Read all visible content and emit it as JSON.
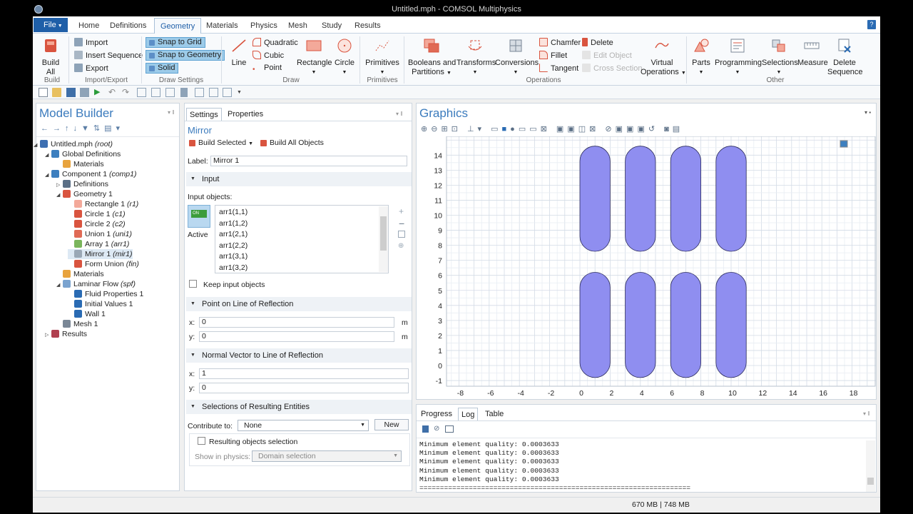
{
  "window": {
    "title": "Untitled.mph - COMSOL Multiphysics"
  },
  "menu": {
    "file_label": "File",
    "tabs": [
      "Home",
      "Definitions",
      "Geometry",
      "Materials",
      "Physics",
      "Mesh",
      "Study",
      "Results"
    ],
    "active_tab": "Geometry",
    "help": "?"
  },
  "ribbon": {
    "build": {
      "big": "Build\nAll",
      "line1": "Build",
      "line2": "All",
      "group": "Build"
    },
    "import_export": {
      "items": [
        "Import",
        "Insert Sequence",
        "Export"
      ],
      "group": "Import/Export"
    },
    "draw_settings": {
      "items": [
        "Snap to Grid",
        "Snap to Geometry",
        "Solid"
      ],
      "group": "Draw Settings"
    },
    "draw": {
      "line": "Line",
      "quadratic": "Quadratic",
      "cubic": "Cubic",
      "point": "Point",
      "rectangle": "Rectangle",
      "circle": "Circle",
      "group": "Draw"
    },
    "primitives": {
      "label": "Primitives",
      "group": "Primitives"
    },
    "operations": {
      "booleans_line1": "Booleans and",
      "booleans_line2": "Partitions",
      "transforms": "Transforms",
      "conversions": "Conversions",
      "chamfer": "Chamfer",
      "fillet": "Fillet",
      "tangent": "Tangent",
      "delete": "Delete",
      "edit_object": "Edit Object",
      "cross_section": "Cross Section",
      "virtual_line1": "Virtual",
      "virtual_line2": "Operations",
      "group": "Operations"
    },
    "other": {
      "parts": "Parts",
      "programming": "Programming",
      "selections": "Selections",
      "measure": "Measure",
      "delete_seq_line1": "Delete",
      "delete_seq_line2": "Sequence",
      "group": "Other"
    }
  },
  "model_builder": {
    "title": "Model Builder",
    "tree": [
      {
        "label": "Untitled.mph",
        "tag": "(root)"
      },
      {
        "label": "Global Definitions",
        "tag": ""
      },
      {
        "label": "Materials",
        "tag": ""
      },
      {
        "label": "Component 1",
        "tag": "(comp1)"
      },
      {
        "label": "Definitions",
        "tag": ""
      },
      {
        "label": "Geometry 1",
        "tag": ""
      },
      {
        "label": "Rectangle 1",
        "tag": "(r1)"
      },
      {
        "label": "Circle 1",
        "tag": "(c1)"
      },
      {
        "label": "Circle 2",
        "tag": "(c2)"
      },
      {
        "label": "Union 1",
        "tag": "(uni1)"
      },
      {
        "label": "Array 1",
        "tag": "(arr1)"
      },
      {
        "label": "Mirror 1",
        "tag": "(mir1)"
      },
      {
        "label": "Form Union",
        "tag": "(fin)"
      },
      {
        "label": "Materials",
        "tag": ""
      },
      {
        "label": "Laminar Flow",
        "tag": "(spf)"
      },
      {
        "label": "Fluid Properties 1",
        "tag": ""
      },
      {
        "label": "Initial Values 1",
        "tag": ""
      },
      {
        "label": "Wall 1",
        "tag": ""
      },
      {
        "label": "Mesh 1",
        "tag": ""
      },
      {
        "label": "Results",
        "tag": ""
      }
    ]
  },
  "settings": {
    "tabs": [
      "Settings",
      "Properties"
    ],
    "node_title": "Mirror",
    "build_selected": "Build Selected",
    "build_all": "Build All Objects",
    "label_caption": "Label:",
    "label_value": "Mirror 1",
    "input_section": "Input",
    "input_objects_caption": "Input objects:",
    "active_toggle": "ON",
    "active_label": "Active",
    "input_objects": [
      "arr1(1,1)",
      "arr1(1,2)",
      "arr1(2,1)",
      "arr1(2,2)",
      "arr1(3,1)",
      "arr1(3,2)"
    ],
    "keep_input": "Keep input objects",
    "point_section": "Point on Line of Reflection",
    "point_x_label": "x:",
    "point_x": "0",
    "point_y_label": "y:",
    "point_y": "0",
    "unit": "m",
    "normal_section": "Normal Vector to Line of Reflection",
    "normal_x_label": "x:",
    "normal_x": "1",
    "normal_y_label": "y:",
    "normal_y": "0",
    "selections_section": "Selections of Resulting Entities",
    "contribute_label": "Contribute to:",
    "contribute_value": "None",
    "new_button": "New",
    "resulting_objects": "Resulting objects selection",
    "show_in_physics": "Show in physics:",
    "show_in_physics_value": "Domain selection"
  },
  "graphics": {
    "title": "Graphics",
    "x_ticks": [
      "-8",
      "-6",
      "-4",
      "-2",
      "0",
      "2",
      "4",
      "6",
      "8",
      "10",
      "12",
      "14",
      "16",
      "18"
    ],
    "y_ticks": [
      "-1",
      "0",
      "1",
      "2",
      "3",
      "4",
      "5",
      "6",
      "7",
      "8",
      "9",
      "10",
      "11",
      "12",
      "13",
      "14"
    ],
    "shape_color": "#8f8ef0",
    "shapes": [
      {
        "cx": 1,
        "y_bottom": 7.6,
        "y_top": 14.6
      },
      {
        "cx": 4,
        "y_bottom": 7.6,
        "y_top": 14.6
      },
      {
        "cx": 7,
        "y_bottom": 7.6,
        "y_top": 14.6
      },
      {
        "cx": 10,
        "y_bottom": 7.6,
        "y_top": 14.6
      },
      {
        "cx": 1,
        "y_bottom": -0.8,
        "y_top": 6.2
      },
      {
        "cx": 4,
        "y_bottom": -0.8,
        "y_top": 6.2
      },
      {
        "cx": 7,
        "y_bottom": -0.8,
        "y_top": 6.2
      },
      {
        "cx": 10,
        "y_bottom": -0.8,
        "y_top": 6.2
      }
    ],
    "shape_radius": 1
  },
  "log": {
    "tabs": [
      "Progress",
      "Log",
      "Table"
    ],
    "active": "Log",
    "lines": [
      "Minimum element quality: 0.0003633",
      "Minimum element quality: 0.0003633",
      "Minimum element quality: 0.0003633",
      "Minimum element quality: 0.0003633",
      "Minimum element quality: 0.0003633",
      "=================================================================="
    ]
  },
  "status": {
    "memory": "670 MB | 748 MB"
  }
}
